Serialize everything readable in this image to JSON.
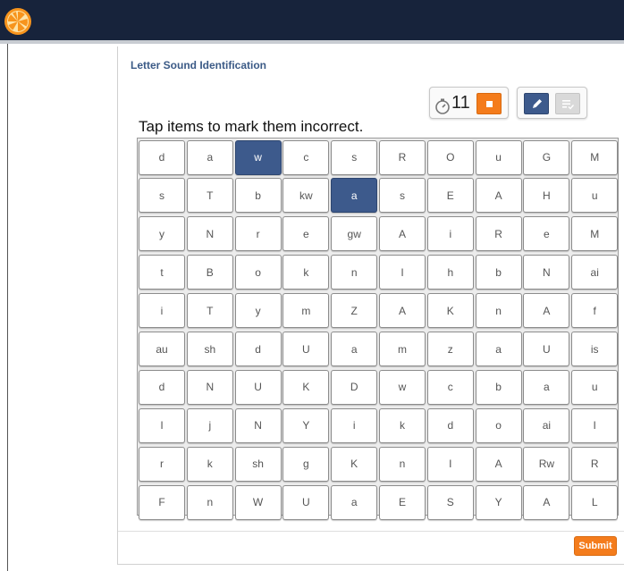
{
  "colors": {
    "topbar": "#17233b",
    "accent_blue": "#3d5a8c",
    "accent_orange": "#f47c1c",
    "title": "#3b5a86"
  },
  "header": {
    "logo_icon": "orange-slice-icon"
  },
  "page": {
    "title": "Letter Sound Identification",
    "instructions": "Tap items to mark them incorrect."
  },
  "timer": {
    "icon": "stopwatch-icon",
    "value": "11",
    "stop_icon": "stop-icon"
  },
  "tools": {
    "pencil_icon": "pencil-icon",
    "check_icon": "checklist-icon"
  },
  "grid": {
    "rows": [
      [
        "d",
        "a",
        "w",
        "c",
        "s",
        "R",
        "O",
        "u",
        "G",
        "M"
      ],
      [
        "s",
        "T",
        "b",
        "kw",
        "a",
        "s",
        "E",
        "A",
        "H",
        "u"
      ],
      [
        "y",
        "N",
        "r",
        "e",
        "gw",
        "A",
        "i",
        "R",
        "e",
        "M"
      ],
      [
        "t",
        "B",
        "o",
        "k",
        "n",
        "I",
        "h",
        "b",
        "N",
        "ai"
      ],
      [
        "i",
        "T",
        "y",
        "m",
        "Z",
        "A",
        "K",
        "n",
        "A",
        "f"
      ],
      [
        "au",
        "sh",
        "d",
        "U",
        "a",
        "m",
        "z",
        "a",
        "U",
        "is"
      ],
      [
        "d",
        "N",
        "U",
        "K",
        "D",
        "w",
        "c",
        "b",
        "a",
        "u"
      ],
      [
        "I",
        "j",
        "N",
        "Y",
        "i",
        "k",
        "d",
        "o",
        "ai",
        "I"
      ],
      [
        "r",
        "k",
        "sh",
        "g",
        "K",
        "n",
        "I",
        "A",
        "Rw",
        "R"
      ],
      [
        "F",
        "n",
        "W",
        "U",
        "a",
        "E",
        "S",
        "Y",
        "A",
        "L"
      ]
    ],
    "marked": [
      [
        0,
        2
      ],
      [
        1,
        4
      ]
    ]
  },
  "footer": {
    "submit_label": "Submit"
  }
}
